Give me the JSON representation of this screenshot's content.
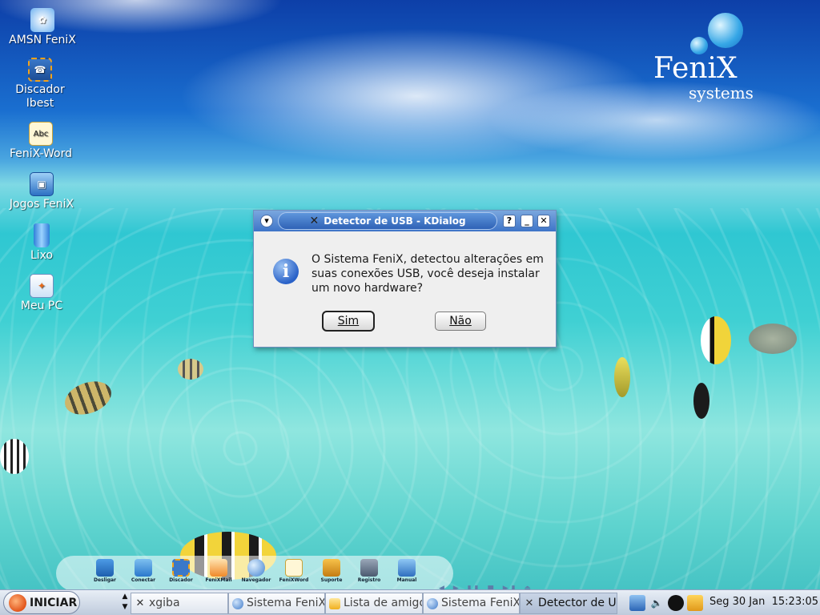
{
  "desktop": {
    "icons": [
      {
        "label": "AMSN FeniX",
        "icon": "amsn-messenger-icon"
      },
      {
        "label": "Discador Ibest",
        "icon": "dialer-icon"
      },
      {
        "label": "FeniX-Word",
        "icon": "word-processor-icon"
      },
      {
        "label": "Jogos FeniX",
        "icon": "games-icon"
      },
      {
        "label": "Lixo",
        "icon": "trash-icon"
      },
      {
        "label": "Meu PC",
        "icon": "computer-icon"
      }
    ],
    "logo": {
      "name": "FeniX",
      "sub": "systems"
    }
  },
  "dialog": {
    "title": "Detector de USB - KDialog",
    "message": "O Sistema FeniX, detectou alterações em suas conexões USB, você deseja instalar um novo hardware?",
    "yes_label": "Sim",
    "no_label": "Não",
    "help_glyph": "?",
    "min_glyph": "_",
    "close_glyph": "✕"
  },
  "quicklaunch": {
    "items": [
      {
        "label": "Desligar"
      },
      {
        "label": "Conectar"
      },
      {
        "label": "Discador"
      },
      {
        "label": "FeniXMail"
      },
      {
        "label": "Navegador"
      },
      {
        "label": "FeniXWord"
      },
      {
        "label": "Suporte"
      },
      {
        "label": "Registro"
      },
      {
        "label": "Manual"
      }
    ]
  },
  "taskbar": {
    "start_label": "INICIAR",
    "tasks": [
      {
        "label": "xgiba"
      },
      {
        "label": "Sistema FeniX"
      },
      {
        "label": "Lista de amigos"
      },
      {
        "label": "Sistema FeniX"
      },
      {
        "label": "Detector de USB"
      }
    ],
    "clock_date": "Seg 30 Jan",
    "clock_time": "15:23:05"
  }
}
